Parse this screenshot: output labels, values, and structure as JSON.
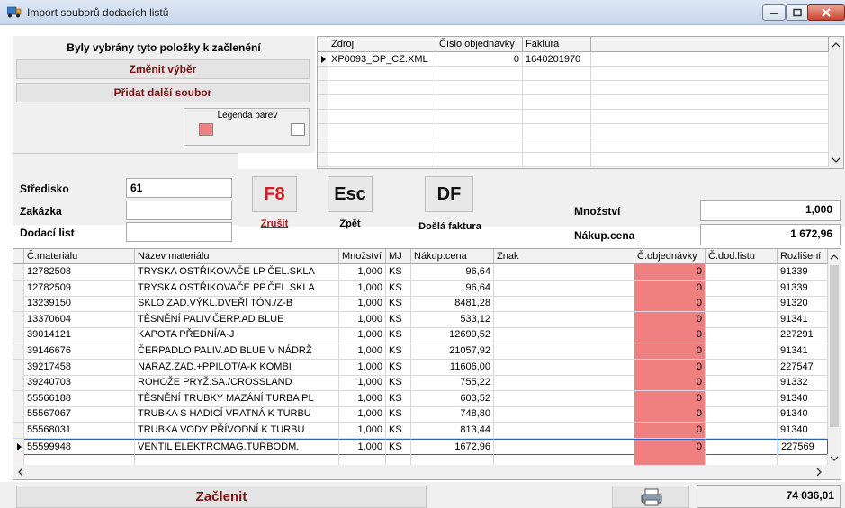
{
  "window": {
    "title": "Import souborů dodacích listů",
    "icon": "truck-icon"
  },
  "left_panel": {
    "heading": "Byly vybrány tyto položky k začlenění",
    "change_selection": "Změnit výběr",
    "add_file": "Přidat další soubor",
    "legend_title": "Legenda barev",
    "legend_colors": [
      "#f08080",
      "#ffffff"
    ]
  },
  "files_grid": {
    "headers": [
      "Zdroj",
      "Číslo objednávky",
      "Faktura"
    ],
    "rows": [
      {
        "zdroj": "XP0093_OP_CZ.XML",
        "cislo": "0",
        "faktura": "1640201970"
      }
    ]
  },
  "form": {
    "stredisko_label": "Středisko",
    "stredisko_value": "61",
    "zakazka_label": "Zakázka",
    "zakazka_value": "",
    "dodaci_label": "Dodací list",
    "dodaci_value": ""
  },
  "actions": {
    "f8_key": "F8",
    "f8_label": "Zrušit",
    "esc_key": "Esc",
    "esc_label": "Zpět",
    "df_key": "DF",
    "df_label": "Došlá faktura"
  },
  "summary": {
    "mnozstvi_label": "Množství",
    "mnozstvi_value": "1,000",
    "nakup_label": "Nákup.cena",
    "nakup_value": "1 672,96"
  },
  "items_grid": {
    "headers": [
      "Č.materiálu",
      "Název materiálu",
      "Množství",
      "MJ",
      "Nákup.cena",
      "Znak",
      "Č.objednávky",
      "Č.dod.listu",
      "Rozlišení"
    ],
    "rows": [
      {
        "mat": "12782508",
        "nazev": "TRYSKA OSTŘIKOVAČE LP ČEL.SKLA",
        "mn": "1,000",
        "mj": "KS",
        "cena": "96,64",
        "znak": "",
        "obj": "0",
        "dod": "",
        "roz": "91339"
      },
      {
        "mat": "12782509",
        "nazev": "TRYSKA OSTŘIKOVAČE PP.ČEL.SKLA",
        "mn": "1,000",
        "mj": "KS",
        "cena": "96,64",
        "znak": "",
        "obj": "0",
        "dod": "",
        "roz": "91339"
      },
      {
        "mat": "13239150",
        "nazev": "SKLO ZAD.VÝKL.DVEŘÍ TÓN./Z-B",
        "mn": "1,000",
        "mj": "KS",
        "cena": "8481,28",
        "znak": "",
        "obj": "0",
        "dod": "",
        "roz": "91320"
      },
      {
        "mat": "13370604",
        "nazev": "TĚSNĚNÍ PALIV.ČERP.AD BLUE",
        "mn": "1,000",
        "mj": "KS",
        "cena": "533,12",
        "znak": "",
        "obj": "0",
        "dod": "",
        "roz": "91341"
      },
      {
        "mat": "39014121",
        "nazev": "KAPOTA PŘEDNÍ/A-J",
        "mn": "1,000",
        "mj": "KS",
        "cena": "12699,52",
        "znak": "",
        "obj": "0",
        "dod": "",
        "roz": "227291"
      },
      {
        "mat": "39146676",
        "nazev": "ČERPADLO PALIV.AD BLUE V NÁDRŽ",
        "mn": "1,000",
        "mj": "KS",
        "cena": "21057,92",
        "znak": "",
        "obj": "0",
        "dod": "",
        "roz": "91341"
      },
      {
        "mat": "39217458",
        "nazev": "NÁRAZ.ZAD.+PPILOT/A-K KOMBI",
        "mn": "1,000",
        "mj": "KS",
        "cena": "11606,00",
        "znak": "",
        "obj": "0",
        "dod": "",
        "roz": "227547"
      },
      {
        "mat": "39240703",
        "nazev": "ROHOŽE PRYŽ.SA./CROSSLAND",
        "mn": "1,000",
        "mj": "KS",
        "cena": "755,22",
        "znak": "",
        "obj": "0",
        "dod": "",
        "roz": "91332"
      },
      {
        "mat": "55566188",
        "nazev": "TĚSNĚNÍ TRUBKY MAZÁNÍ TURBA PL",
        "mn": "1,000",
        "mj": "KS",
        "cena": "603,52",
        "znak": "",
        "obj": "0",
        "dod": "",
        "roz": "91340"
      },
      {
        "mat": "55567067",
        "nazev": "TRUBKA S HADICÍ VRATNÁ K TURBU",
        "mn": "1,000",
        "mj": "KS",
        "cena": "748,80",
        "znak": "",
        "obj": "0",
        "dod": "",
        "roz": "91340"
      },
      {
        "mat": "55568031",
        "nazev": "TRUBKA VODY PŘÍVODNÍ K TURBU",
        "mn": "1,000",
        "mj": "KS",
        "cena": "813,44",
        "znak": "",
        "obj": "0",
        "dod": "",
        "roz": "91340"
      },
      {
        "mat": "55599948",
        "nazev": "VENTIL ELEKTROMAG.TURBODM.",
        "mn": "1,000",
        "mj": "KS",
        "cena": "1672,96",
        "znak": "",
        "obj": "0",
        "dod": "",
        "roz": "227569"
      }
    ]
  },
  "footer": {
    "zaclenit": "Začlenit",
    "total": "74 036,01",
    "print_icon": "printer-icon"
  }
}
